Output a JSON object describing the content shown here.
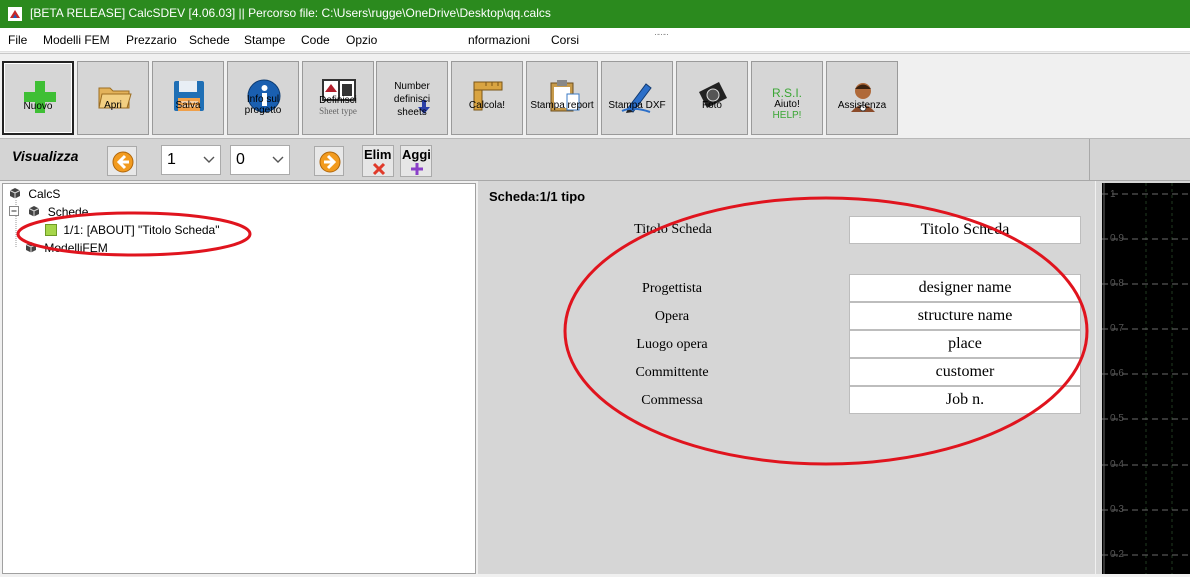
{
  "titlebar": {
    "title": "[BETA RELEASE] CalcSDEV [4.06.03] || Percorso file: C:\\Users\\rugge\\OneDrive\\Desktop\\qq.calcs"
  },
  "menu": {
    "file": "File",
    "modelli": "Modelli FEM",
    "prezzario": "Prezzario",
    "schede": "Schede",
    "stampe": "Stampe",
    "code": "Code",
    "opzioni": "Opzio",
    "informazioni": "nformazioni",
    "corsi": "Corsi",
    "extra": "·-·-·"
  },
  "toolbar": {
    "nuovo": "Nuovo",
    "apri": "Apri",
    "salva": "Salva",
    "info_1": "Info sul",
    "info_2": "progetto",
    "definisci_1": "Definisci",
    "definisci_2": "Sheet type",
    "number_1": "Number",
    "number_2": "definisci",
    "number_3": "sheets",
    "calcola": "Calcola!",
    "stampa_report": "Stampa report",
    "stampa_dxf": "Stampa DXF",
    "foto": "Foto",
    "aiuto_1": "R.S.I.",
    "aiuto_2": "Aiuto!",
    "aiuto_3": "HELP!",
    "assistenza": "Assistenza"
  },
  "nav": {
    "visualizza": "Visualizza",
    "combo1": "1",
    "combo2": "0",
    "elim": "Elim",
    "aggi": "Aggi"
  },
  "tree": {
    "root": "CalcS",
    "schede": "Schede",
    "item": "1/1: [ABOUT] \"Titolo Scheda\"",
    "modelli": "ModelliFEM"
  },
  "sheet": {
    "header": "Scheda:1/1 tipo",
    "titolo_label": "Titolo Scheda",
    "titolo_value": "Titolo Scheda",
    "fields": [
      {
        "label": "Progettista",
        "value": "designer name"
      },
      {
        "label": "Opera",
        "value": "structure name"
      },
      {
        "label": "Luogo opera",
        "value": "place"
      },
      {
        "label": "Committente",
        "value": "customer"
      },
      {
        "label": "Commessa",
        "value": "Job n."
      }
    ]
  },
  "chart": {
    "yticks": [
      "1",
      "0.9",
      "0.8",
      "0.7",
      "0.6",
      "0.5",
      "0.4",
      "0.3",
      "0.2"
    ]
  },
  "colors": {
    "titlebar": "#2b8a1e",
    "annotation": "#e0141e"
  }
}
